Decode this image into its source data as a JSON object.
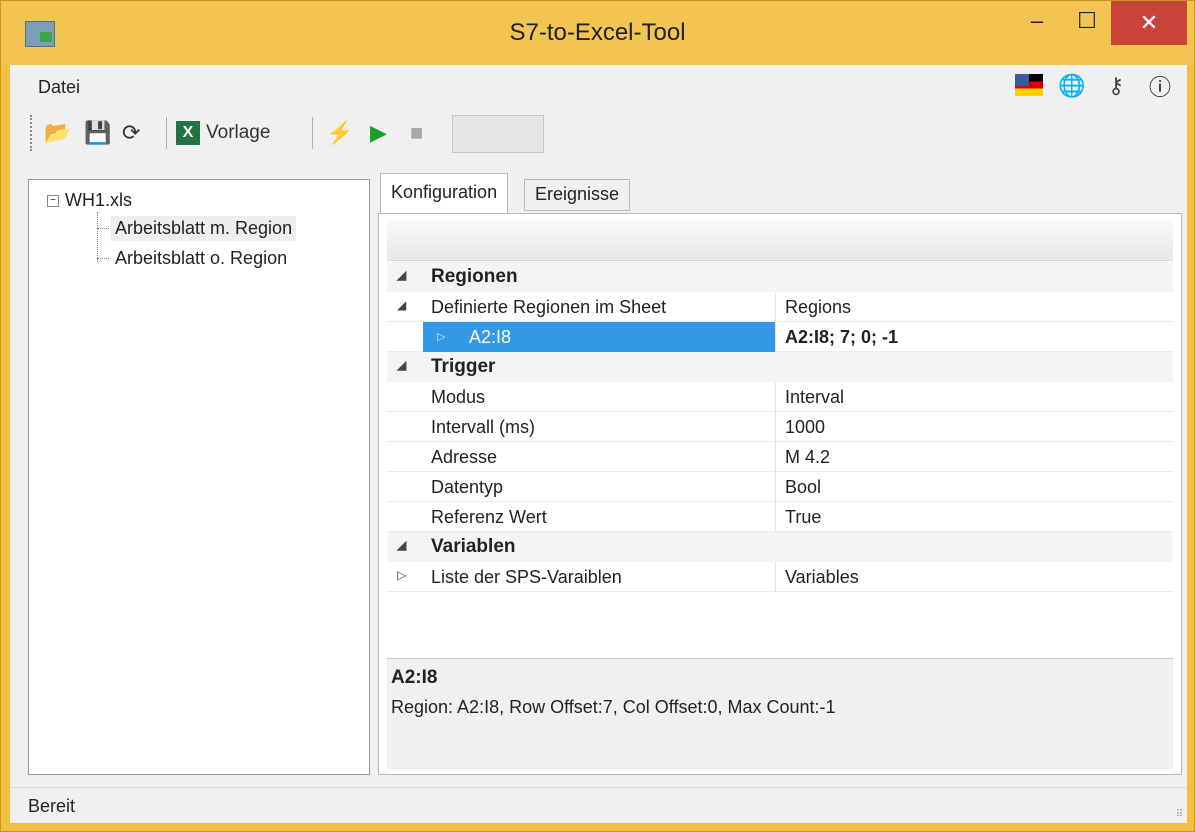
{
  "window": {
    "title": "S7-to-Excel-Tool",
    "minimize": "‒",
    "maximize": "☐",
    "close": "✕"
  },
  "menu": {
    "file": "Datei"
  },
  "toolbar": {
    "vorlage_label": "Vorlage"
  },
  "tree": {
    "root": "WH1.xls",
    "children": [
      {
        "label": "Arbeitsblatt m. Region",
        "selected": true
      },
      {
        "label": "Arbeitsblatt o. Region",
        "selected": false
      }
    ]
  },
  "tabs": {
    "configuration": "Konfiguration",
    "events": "Ereignisse"
  },
  "grid": {
    "cat_regions": "Regionen",
    "defined_regions_name": "Definierte Regionen im Sheet",
    "defined_regions_value": "Regions",
    "region_item_name": "A2:I8",
    "region_item_value": "A2:I8; 7; 0; -1",
    "cat_trigger": "Trigger",
    "mode_name": "Modus",
    "mode_value": "Interval",
    "interval_name": "Intervall (ms)",
    "interval_value": "1000",
    "address_name": "Adresse",
    "address_value": "M 4.2",
    "datatype_name": "Datentyp",
    "datatype_value": "Bool",
    "refvalue_name": "Referenz Wert",
    "refvalue_value": "True",
    "cat_variables": "Variablen",
    "varlist_name": "Liste der SPS-Varaiblen",
    "varlist_value": "Variables"
  },
  "description": {
    "title": "A2:I8",
    "text": "Region: A2:I8, Row Offset:7, Col Offset:0, Max Count:-1"
  },
  "status": {
    "text": "Bereit"
  },
  "colors": {
    "titlebar": "#f2c552",
    "selection": "#3399e6",
    "close": "#c9453a"
  }
}
